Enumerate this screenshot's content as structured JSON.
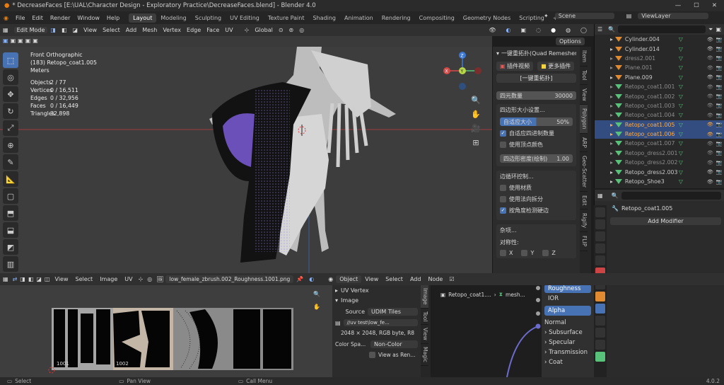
{
  "window": {
    "title": "* DecreaseFaces [E:\\UAL\\Character Design - Exploratory Practice\\DecreaseFaces.blend] - Blender 4.0"
  },
  "menu": [
    "File",
    "Edit",
    "Render",
    "Window",
    "Help"
  ],
  "workspaces": [
    "Layout",
    "Modeling",
    "Sculpting",
    "UV Editing",
    "Texture Paint",
    "Shading",
    "Animation",
    "Rendering",
    "Compositing",
    "Geometry Nodes",
    "Scripting"
  ],
  "scene": {
    "label": "Scene",
    "view_layer": "ViewLayer"
  },
  "viewport_header": {
    "mode": "Edit Mode",
    "menus": [
      "View",
      "Select",
      "Add",
      "Mesh",
      "Vertex",
      "Edge",
      "Face",
      "UV"
    ],
    "orientation": "Global",
    "options_label": "Options"
  },
  "viewport_info": {
    "view": "Front Orthographic",
    "object": "(183) Retopo_coat1.005",
    "units": "Meters",
    "stats": [
      {
        "label": "Objects",
        "value": "2 / 77"
      },
      {
        "label": "Vertices",
        "value": "0 / 16,511"
      },
      {
        "label": "Edges",
        "value": "0 / 32,956"
      },
      {
        "label": "Faces",
        "value": "0 / 16,449"
      },
      {
        "label": "Triangles",
        "value": "32,898"
      }
    ]
  },
  "npanel": {
    "title": "一键重拓扑(Quad Remesher 8",
    "plugin_video": "插件视频",
    "more_plugins": "更多插件",
    "one_click": "[一键重拓扑]",
    "quad_count_label": "四元数量",
    "quad_count_value": "30000",
    "quad_size_header": "四边形大小设置...",
    "adaptive_label": "自适应大小",
    "adaptive_value": "50%",
    "adaptive_quad_label": "自适应四进制数量",
    "use_vertex_color": "使用顶点颜色",
    "density_label": "四边形密度(绘制)",
    "density_value": "1.00",
    "edge_loop_header": "边循环控制...",
    "use_material": "使用材质",
    "use_normal_split": "使用法向拆分",
    "angle_detect": "按角度检测硬边",
    "misc_header": "杂项...",
    "symmetry_label": "对称性:",
    "axes": [
      "X",
      "Y",
      "Z"
    ],
    "tabs": [
      "Item",
      "Tool",
      "View",
      "Polygon",
      "ARP",
      "Geo-Scatter",
      "Edit",
      "Rigify",
      "FLIP"
    ]
  },
  "outliner": {
    "items": [
      {
        "name": "Cylinder.004",
        "type": "orange",
        "state": "normal"
      },
      {
        "name": "Cylinder.014",
        "type": "orange",
        "state": "normal"
      },
      {
        "name": "dress2.001",
        "type": "orange",
        "state": "dim"
      },
      {
        "name": "Plane.001",
        "type": "orange",
        "state": "dim"
      },
      {
        "name": "Plane.009",
        "type": "orange",
        "state": "normal"
      },
      {
        "name": "Retopo_coat1.001",
        "type": "green",
        "state": "dim"
      },
      {
        "name": "Retopo_coat1.002",
        "type": "green",
        "state": "dim"
      },
      {
        "name": "Retopo_coat1.003",
        "type": "green",
        "state": "dim"
      },
      {
        "name": "Retopo_coat1.004",
        "type": "green",
        "state": "dim"
      },
      {
        "name": "Retopo_coat1.005",
        "type": "green",
        "state": "sel"
      },
      {
        "name": "Retopo_coat1.006",
        "type": "green",
        "state": "sel"
      },
      {
        "name": "Retopo_coat1.007",
        "type": "green",
        "state": "dim"
      },
      {
        "name": "Retopo_dress2.001",
        "type": "green",
        "state": "dim"
      },
      {
        "name": "Retopo_dress2.002",
        "type": "green",
        "state": "dim"
      },
      {
        "name": "Retopo_dress2.003",
        "type": "green",
        "state": "normal"
      },
      {
        "name": "Retopo_Shoe3",
        "type": "green",
        "state": "normal"
      }
    ]
  },
  "properties": {
    "object_name": "Retopo_coat1.005",
    "add_modifier": "Add Modifier"
  },
  "uv_header": {
    "menus": [
      "View",
      "Select",
      "Image",
      "UV"
    ],
    "image_name": "low_female_zbrush.002_Roughness.1001.png"
  },
  "uv_sidebar": {
    "uv_vertex": "UV Vertex",
    "image": "Image",
    "source_label": "Source",
    "source_value": "UDIM Tiles",
    "path": "//uv test\\low_fe...",
    "info": "2048 × 2048, RGB byte, R8",
    "color_space_label": "Color Spa...",
    "color_space_value": "Non-Color",
    "view_as_render": "View as Ren...",
    "tabs": [
      "Image",
      "Tool",
      "View",
      "Magic"
    ]
  },
  "uv_tiles": [
    "1001",
    "1002"
  ],
  "node_header": {
    "object": "Object",
    "menus": [
      "View",
      "Select",
      "Add",
      "Node"
    ],
    "breadcrumb_object": "Retopo_coat1....",
    "breadcrumb_mesh": "mesh..."
  },
  "node_sockets": [
    "Roughness",
    "IOR",
    "Alpha",
    "Normal",
    "Subsurface",
    "Specular",
    "Transmission",
    "Coat"
  ],
  "status": {
    "select": "Select",
    "pan": "Pan View",
    "call_menu": "Call Menu",
    "version": "4.0.2"
  },
  "colors": {
    "accent": "#4772b3",
    "object_orange": "#e08b32",
    "mesh_green": "#58c27a",
    "purple": "#7b5fd0"
  }
}
